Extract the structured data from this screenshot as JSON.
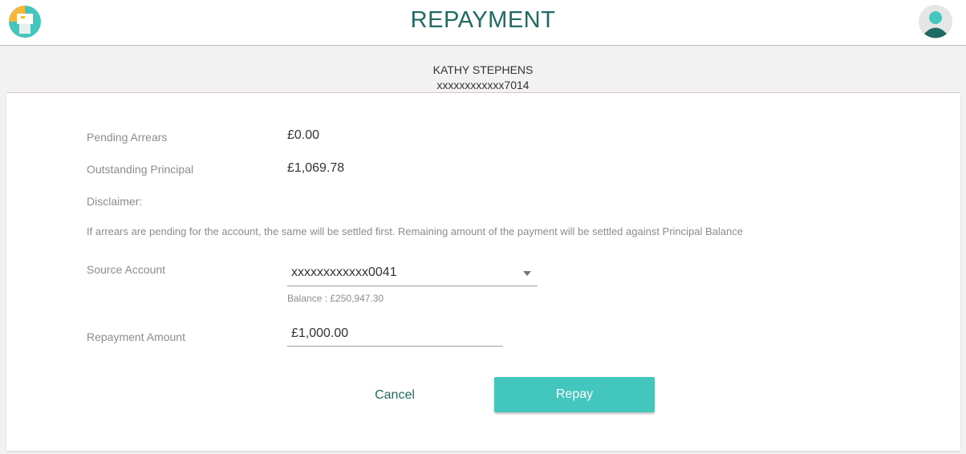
{
  "header": {
    "title": "REPAYMENT",
    "logo_icon": "app-logo-icon",
    "avatar_icon": "user-avatar-icon"
  },
  "customer": {
    "name": "KATHY STEPHENS",
    "account_masked": "xxxxxxxxxxxx7014"
  },
  "details": {
    "pending_arrears_label": "Pending Arrears",
    "pending_arrears_value": "£0.00",
    "outstanding_principal_label": "Outstanding Principal",
    "outstanding_principal_value": "£1,069.78",
    "disclaimer_label": "Disclaimer:",
    "disclaimer_text": "If arrears are pending for the account, the same will be settled first. Remaining amount of the payment will be settled against Principal Balance"
  },
  "form": {
    "source_account_label": "Source Account",
    "source_account_value": "xxxxxxxxxxxx0041",
    "balance_text": "Balance : £250,947.30",
    "repayment_amount_label": "Repayment Amount",
    "repayment_amount_value": "£1,000.00"
  },
  "actions": {
    "cancel_label": "Cancel",
    "repay_label": "Repay"
  },
  "colors": {
    "accent": "#43c6bd",
    "title": "#1f6b63"
  }
}
